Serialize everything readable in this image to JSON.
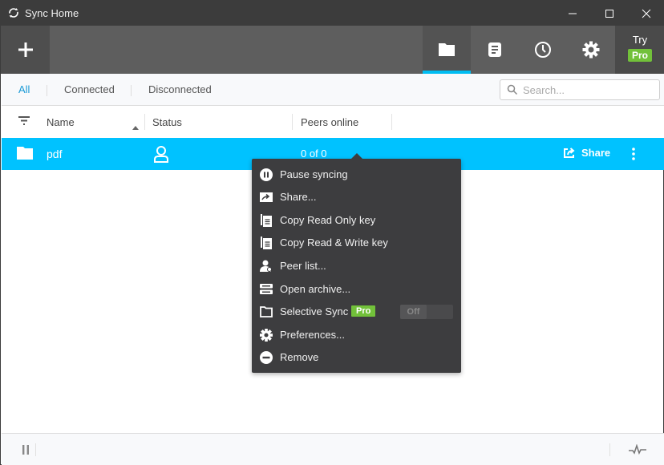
{
  "window": {
    "title": "Sync Home",
    "icons": {
      "app": "sync-icon",
      "minimize": "minimize-icon",
      "maximize": "maximize-icon",
      "close": "close-icon"
    }
  },
  "toolbar": {
    "add_icon": "plus-icon",
    "tabs": [
      {
        "name": "folders",
        "icon": "folder-icon",
        "active": true
      },
      {
        "name": "transfers",
        "icon": "document-icon",
        "active": false
      },
      {
        "name": "history",
        "icon": "clock-icon",
        "active": false
      },
      {
        "name": "settings",
        "icon": "gear-icon",
        "active": false
      }
    ],
    "try_label": "Try",
    "pro_label": "Pro"
  },
  "filters": {
    "items": [
      {
        "label": "All",
        "active": true
      },
      {
        "label": "Connected",
        "active": false
      },
      {
        "label": "Disconnected",
        "active": false
      }
    ],
    "search_placeholder": "Search...",
    "search_value": ""
  },
  "table": {
    "columns": [
      "Name",
      "Status",
      "Peers online"
    ],
    "sort_column": "Name",
    "sort_direction": "ascending",
    "rows": [
      {
        "name": "pdf",
        "status_icon": "user-icon",
        "peers": "0 of 0",
        "share_label": "Share",
        "selected": true
      }
    ]
  },
  "context_menu": {
    "items": [
      {
        "label": "Pause syncing",
        "icon": "pause-circle-icon"
      },
      {
        "label": "Share...",
        "icon": "share-icon"
      },
      {
        "label": "Copy Read Only key",
        "icon": "copy-icon"
      },
      {
        "label": "Copy Read & Write key",
        "icon": "copy-icon"
      },
      {
        "label": "Peer list...",
        "icon": "peers-icon"
      },
      {
        "label": "Open archive...",
        "icon": "archive-icon"
      },
      {
        "label": "Selective Sync",
        "icon": "folder-outline-icon",
        "badge": "Pro",
        "toggle": "Off"
      },
      {
        "label": "Preferences...",
        "icon": "gear-icon"
      },
      {
        "label": "Remove",
        "icon": "remove-icon"
      }
    ]
  },
  "colors": {
    "accent": "#00c2ff",
    "active_filter": "#1a9ad6",
    "pro_badge": "#72c13a",
    "titlebar": "#3c3c3c",
    "toolbar": "#5e5e5e",
    "menu_bg": "#3d3d3f"
  }
}
